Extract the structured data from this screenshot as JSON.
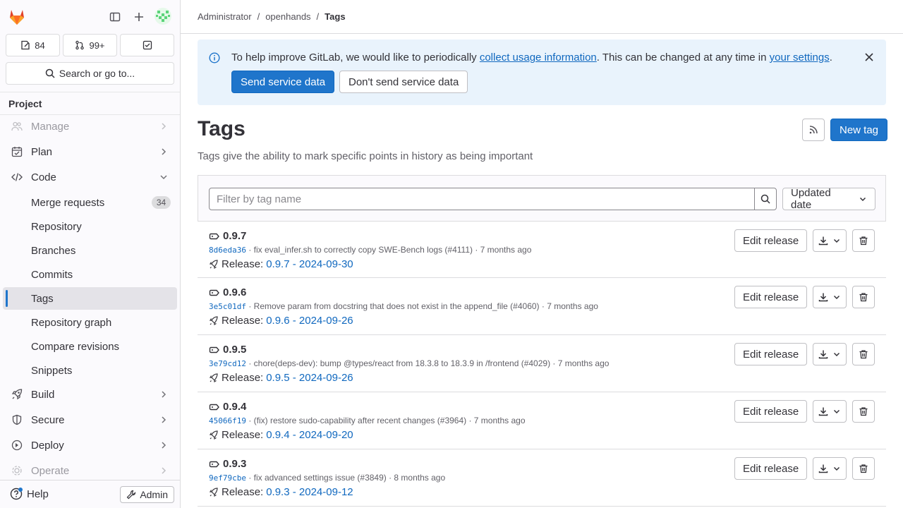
{
  "sidebar": {
    "counters": {
      "issues": "84",
      "merge_requests": "99+"
    },
    "search_label": "Search or go to...",
    "section_header": "Project",
    "nav": {
      "manage": "Manage",
      "plan": "Plan",
      "code": "Code",
      "build": "Build",
      "secure": "Secure",
      "deploy": "Deploy",
      "operate": "Operate"
    },
    "code_items": {
      "merge_requests": "Merge requests",
      "merge_requests_count": "34",
      "repository": "Repository",
      "branches": "Branches",
      "commits": "Commits",
      "tags": "Tags",
      "repository_graph": "Repository graph",
      "compare_revisions": "Compare revisions",
      "snippets": "Snippets"
    },
    "help": "Help",
    "admin": "Admin"
  },
  "breadcrumb": {
    "first": "Administrator",
    "second": "openhands",
    "current": "Tags",
    "separator": "/"
  },
  "alert": {
    "text_before": "To help improve GitLab, we would like to periodically ",
    "link1": "collect usage information",
    "text_middle": ". This can be changed at any time in ",
    "link2": "your settings",
    "text_after": ".",
    "send_button": "Send service data",
    "dont_send_button": "Don't send service data"
  },
  "page": {
    "title": "Tags",
    "subtitle": "Tags give the ability to mark specific points in history as being important",
    "new_tag_button": "New tag"
  },
  "filter": {
    "placeholder": "Filter by tag name",
    "sort_label": "Updated date"
  },
  "tags": [
    {
      "name": "0.9.7",
      "sha": "8d6eda36",
      "message": " · fix eval_infer.sh to correctly copy SWE-Bench logs (#4111) · 7 months ago",
      "release_label": "Release:",
      "release": "0.9.7 - 2024-09-30",
      "edit": "Edit release"
    },
    {
      "name": "0.9.6",
      "sha": "3e5c01df",
      "message": " · Remove param from docstring that does not exist in the append_file (#4060) · 7 months ago",
      "release_label": "Release:",
      "release": "0.9.6 - 2024-09-26",
      "edit": "Edit release"
    },
    {
      "name": "0.9.5",
      "sha": "3e79cd12",
      "message": " · chore(deps-dev): bump @types/react from 18.3.8 to 18.3.9 in /frontend (#4029) · 7 months ago",
      "release_label": "Release:",
      "release": "0.9.5 - 2024-09-26",
      "edit": "Edit release"
    },
    {
      "name": "0.9.4",
      "sha": "45066f19",
      "message": " · (fix) restore sudo-capability after recent changes (#3964) · 7 months ago",
      "release_label": "Release:",
      "release": "0.9.4 - 2024-09-20",
      "edit": "Edit release"
    },
    {
      "name": "0.9.3",
      "sha": "9ef79cbe",
      "message": " · fix advanced settings issue (#3849) · 8 months ago",
      "release_label": "Release:",
      "release": "0.9.3 - 2024-09-12",
      "edit": "Edit release"
    }
  ],
  "colors": {
    "primary": "#1f75cb",
    "link": "#1068bf",
    "alert_bg": "#e9f3fc",
    "sidebar_bg": "#fbfafd",
    "logo": "#e24329"
  }
}
